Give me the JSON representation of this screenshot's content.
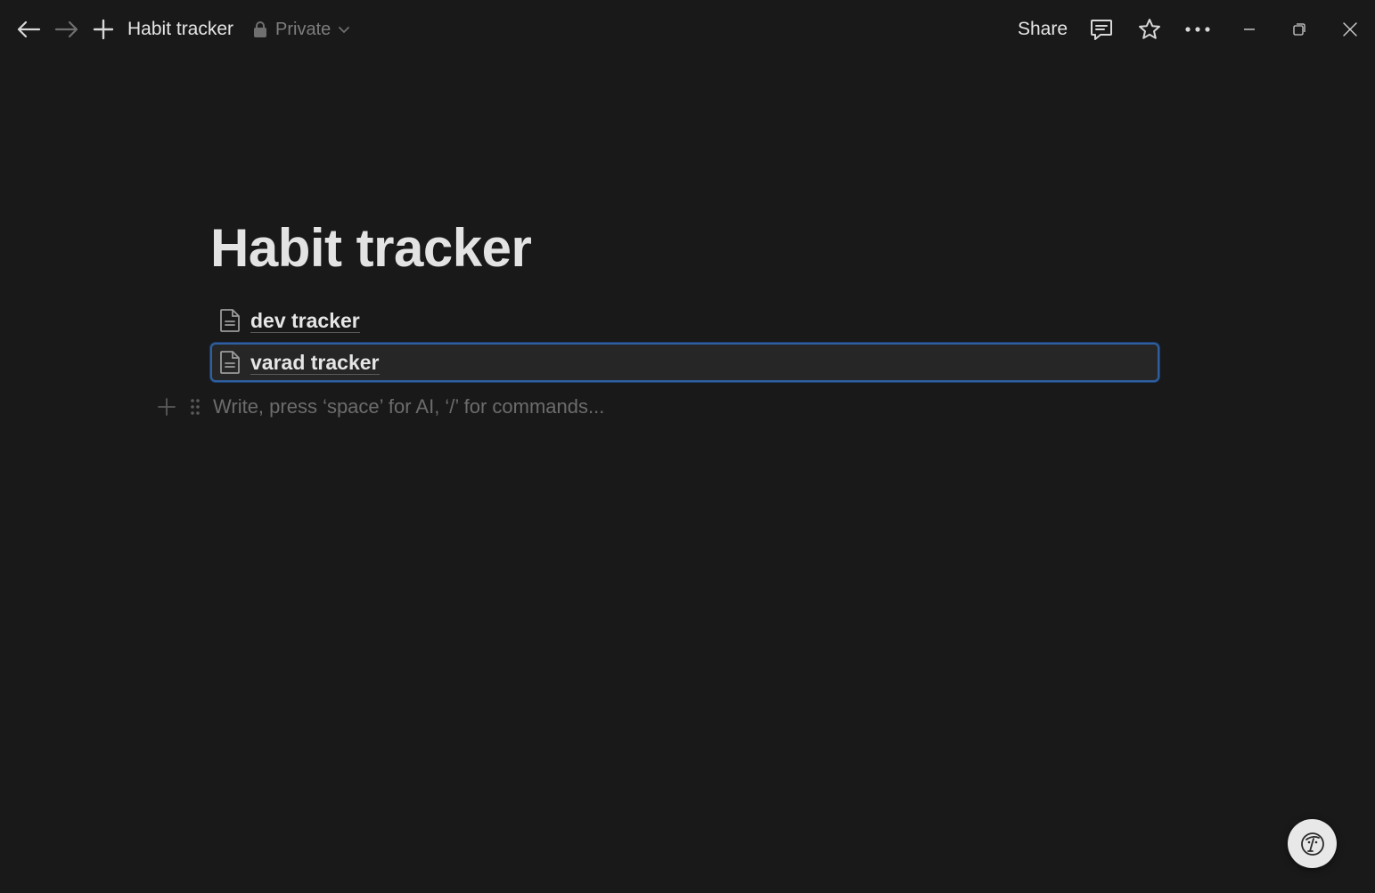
{
  "topbar": {
    "back_icon": "arrow-left-icon",
    "forward_icon": "arrow-right-icon",
    "new_icon": "plus-icon",
    "breadcrumb": "Habit tracker",
    "privacy_label": "Private",
    "share_label": "Share",
    "comments_icon": "comment-icon",
    "favorite_icon": "star-icon",
    "more_icon": "ellipsis-icon",
    "window_controls": [
      "minimize-icon",
      "restore-icon",
      "close-icon"
    ]
  },
  "page": {
    "title": "Habit tracker",
    "subpages": [
      {
        "label": "dev tracker",
        "icon": "page-icon"
      },
      {
        "label": "varad tracker",
        "icon": "page-icon",
        "selected": true
      }
    ],
    "placeholder": "Write, press ‘space’ for AI, ‘/’ for commands..."
  },
  "assistant": {
    "icon": "ai-assistant-icon"
  },
  "colors": {
    "background": "#191919",
    "selection_border": "#2f5fa0",
    "text": "#e6e6e6",
    "muted": "#6c6c6c"
  }
}
